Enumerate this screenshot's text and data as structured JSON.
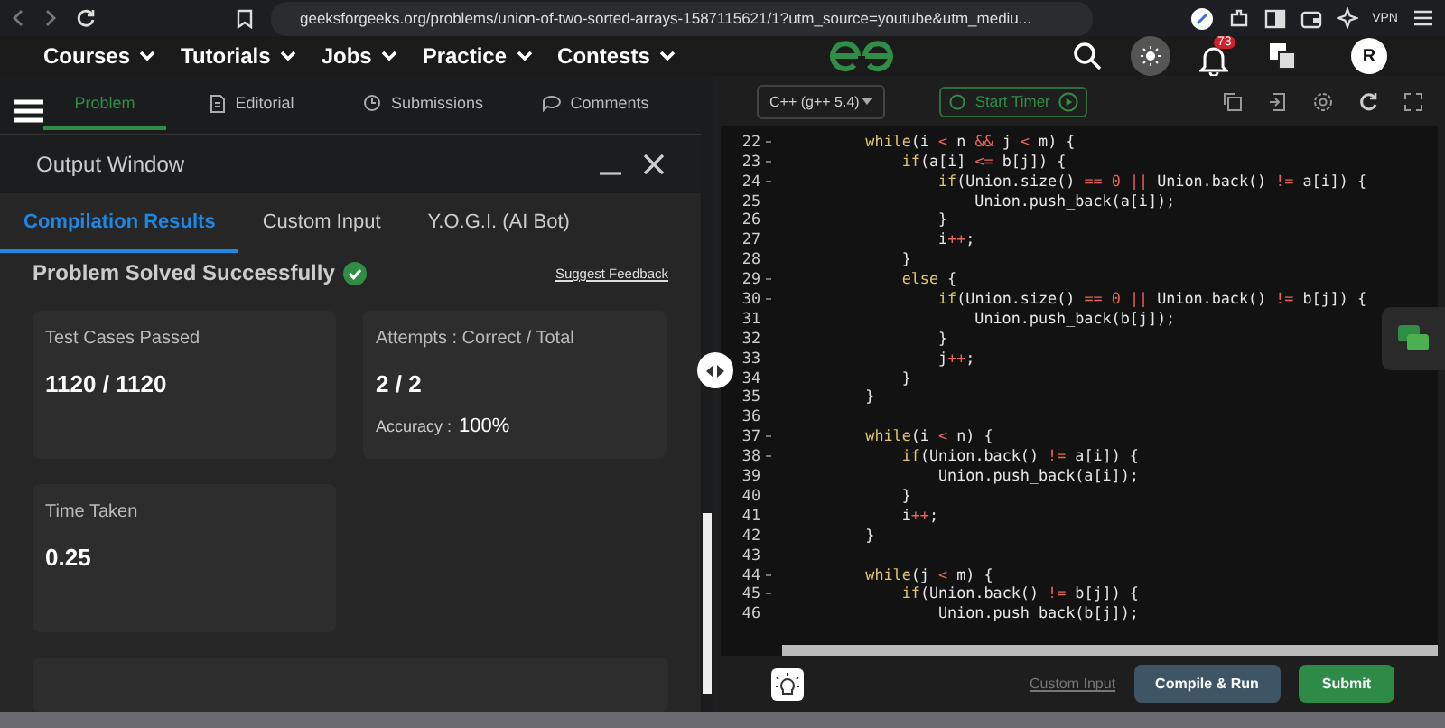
{
  "browser": {
    "url": "geeksforgeeks.org/problems/union-of-two-sorted-arrays-1587115621/1?utm_source=youtube&utm_mediu...",
    "vpn": "VPN"
  },
  "nav": {
    "items": [
      "Courses",
      "Tutorials",
      "Jobs",
      "Practice",
      "Contests"
    ],
    "notifications": "73",
    "avatar": "R"
  },
  "problem_tabs": [
    {
      "label": "Problem",
      "selected": true
    },
    {
      "label": "Editorial",
      "selected": false
    },
    {
      "label": "Submissions",
      "selected": false
    },
    {
      "label": "Comments",
      "selected": false
    }
  ],
  "output_window": {
    "title": "Output Window",
    "tabs": [
      {
        "label": "Compilation Results",
        "selected": true
      },
      {
        "label": "Custom Input",
        "selected": false
      },
      {
        "label": "Y.O.G.I. (AI Bot)",
        "selected": false
      }
    ],
    "status": "Problem Solved Successfully",
    "feedback_link": "Suggest Feedback",
    "cards": [
      {
        "label": "Test Cases Passed",
        "value": "1120 / 1120"
      },
      {
        "label": "Attempts : Correct / Total",
        "value": "2 / 2",
        "sub_label": "Accuracy :",
        "sub_value": "100%"
      },
      {
        "label": "Time Taken",
        "value": "0.25"
      }
    ]
  },
  "editor": {
    "language": "C++ (g++ 5.4)",
    "timer": "Start Timer",
    "lines": [
      {
        "n": "22",
        "fold": true,
        "code": "    while(i < n && j < m) {"
      },
      {
        "n": "23",
        "fold": true,
        "code": "        if(a[i] <= b[j]) {"
      },
      {
        "n": "24",
        "fold": true,
        "code": "            if(Union.size() == 0 || Union.back() != a[i]) {"
      },
      {
        "n": "25",
        "fold": false,
        "code": "                Union.push_back(a[i]);"
      },
      {
        "n": "26",
        "fold": false,
        "code": "            }"
      },
      {
        "n": "27",
        "fold": false,
        "code": "            i++;"
      },
      {
        "n": "28",
        "fold": false,
        "code": "        }"
      },
      {
        "n": "29",
        "fold": true,
        "code": "        else {"
      },
      {
        "n": "30",
        "fold": true,
        "code": "            if(Union.size() == 0 || Union.back() != b[j]) {"
      },
      {
        "n": "31",
        "fold": false,
        "code": "                Union.push_back(b[j]);"
      },
      {
        "n": "32",
        "fold": false,
        "code": "            }"
      },
      {
        "n": "33",
        "fold": false,
        "code": "            j++;"
      },
      {
        "n": "34",
        "fold": false,
        "code": "        }"
      },
      {
        "n": "35",
        "fold": false,
        "code": "    }"
      },
      {
        "n": "36",
        "fold": false
      },
      {
        "n": "37",
        "fold": true,
        "code": "    while(i < n) {"
      },
      {
        "n": "38",
        "fold": true,
        "code": "        if(Union.back() != a[i]) {"
      },
      {
        "n": "39",
        "fold": false,
        "code": "            Union.push_back(a[i]);"
      },
      {
        "n": "40",
        "fold": false,
        "code": "        }"
      },
      {
        "n": "41",
        "fold": false,
        "code": "        i++;"
      },
      {
        "n": "42",
        "fold": false,
        "code": "    }"
      },
      {
        "n": "43",
        "fold": false
      },
      {
        "n": "44",
        "fold": true,
        "code": "    while(j < m) {"
      },
      {
        "n": "45",
        "fold": true,
        "code": "        if(Union.back() != b[j]) {"
      },
      {
        "n": "46",
        "fold": false,
        "code": "            Union.push_back(b[j]);"
      }
    ],
    "custom_input": "Custom Input",
    "compile": "Compile & Run",
    "submit": "Submit"
  }
}
